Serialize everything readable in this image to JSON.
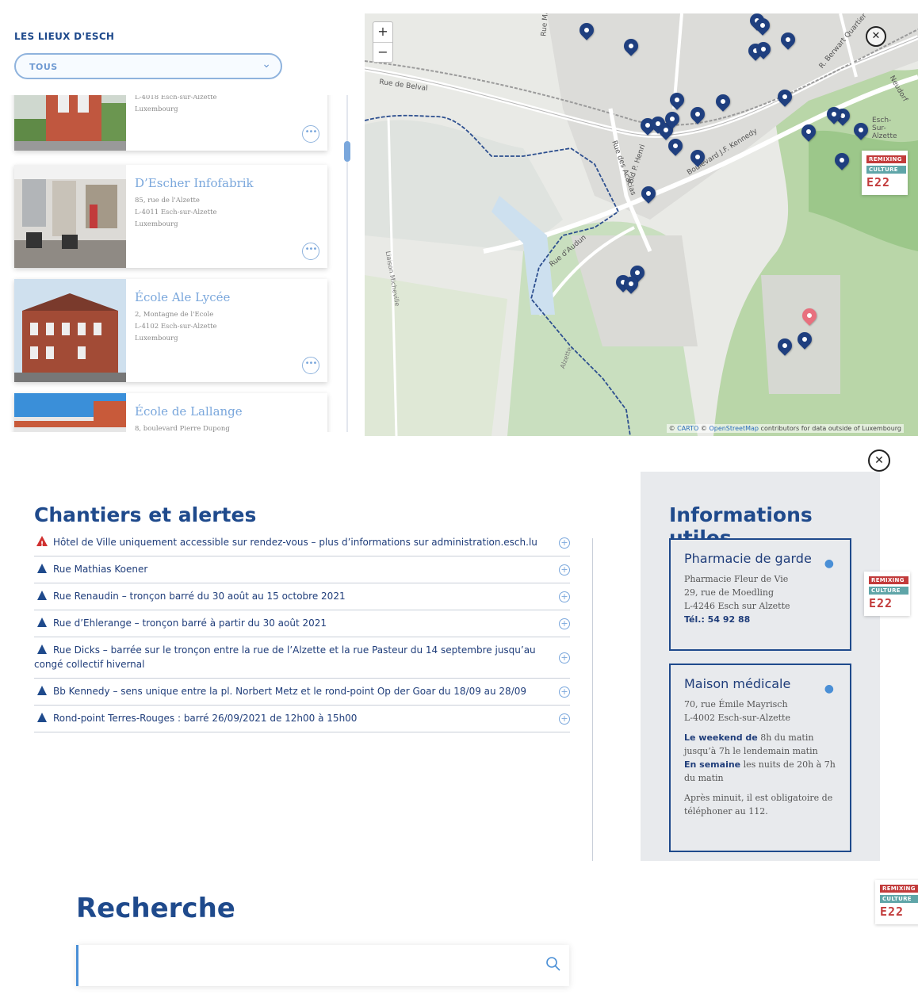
{
  "places": {
    "title": "LES LIEUX D'ESCH",
    "filter_value": "TOUS",
    "cards": [
      {
        "name": "",
        "address": [
          "L-4018 Esch-sur-Alzette",
          "Luxembourg"
        ]
      },
      {
        "name": "D’Escher Infofabrik",
        "address": [
          "85, rue de l'Alzette",
          "L-4011 Esch-sur-Alzette",
          "Luxembourg"
        ]
      },
      {
        "name": "École Ale Lycée",
        "address": [
          "2, Montagne de l'Ecole",
          "L-4102 Esch-sur-Alzette",
          "Luxembourg"
        ]
      },
      {
        "name": "École de Lallange",
        "address": [
          "8, boulevard Pierre Dupong"
        ]
      }
    ]
  },
  "map": {
    "zoom_in": "+",
    "zoom_out": "−",
    "labels": {
      "rue_de_belval": "Rue de Belval",
      "rue_des_acacias": "Rue des Acacias",
      "bld_henri": "Bld P. Henri",
      "bld_kennedy": "Boulevard J.F. Kennedy",
      "rue_audun": "Rue d'Audun",
      "quartier": "R. Berwart Quartier",
      "esch_sur_alzette": "Esch-Sur-Alzette",
      "rue_neudorf": "Neudorf",
      "alzette": "Alzette",
      "liaison": "Liaison Micheville",
      "rue_mai": "Rue Mai"
    },
    "attribution_prefix": "© ",
    "attribution_carto": "CARTO",
    "attribution_osm": "OpenStreetMap",
    "attribution_suffix": " contributors for data outside of Luxembourg"
  },
  "badge": {
    "line1": "REMIXING",
    "line2": "CULTURE",
    "line3": "E22"
  },
  "alerts": {
    "title": "Chantiers et alertes",
    "items": [
      {
        "icon": "warning-icon",
        "text": "Hôtel de Ville uniquement accessible sur rendez-vous – plus d’informations sur administration.esch.lu"
      },
      {
        "icon": "cone-icon",
        "text": "Rue Mathias Koener"
      },
      {
        "icon": "cone-icon",
        "text": "Rue Renaudin – tronçon barré du 30 août au 15 octobre 2021"
      },
      {
        "icon": "cone-icon",
        "text": "Rue d’Ehlerange – tronçon barré à partir du 30 août 2021"
      },
      {
        "icon": "cone-icon",
        "text": "Rue Dicks – barrée sur le tronçon entre la rue de l’Alzette et la rue Pasteur du 14 septembre jusqu’au congé collectif hivernal"
      },
      {
        "icon": "cone-icon",
        "text": "Bb Kennedy – sens unique entre la pl. Norbert Metz et le rond-point Op der Goar du 18/09 au 28/09"
      },
      {
        "icon": "cone-icon",
        "text": "Rond-point Terres-Rouges : barré 26/09/2021 de 12h00 à 15h00"
      }
    ]
  },
  "infos": {
    "title": "Informations utiles",
    "pharmacie": {
      "title": "Pharmacie de garde",
      "lines": [
        "Pharmacie Fleur de Vie",
        "29, rue de Moedling",
        "L-4246 Esch sur Alzette"
      ],
      "tel": "Tél.: 54 92 88"
    },
    "maison": {
      "title": "Maison médicale",
      "lines": [
        "70, rue Émile Mayrisch",
        "L-4002 Esch-sur-Alzette"
      ],
      "weekend_label": "Le weekend de",
      "weekend_text": " 8h du matin jusqu’à 7h le lendemain matin",
      "semaine_label": "En semaine",
      "semaine_text": " les nuits de 20h à 7h du matin",
      "note": "Après minuit, il est obligatoire de téléphoner au 112."
    }
  },
  "search": {
    "title": "Recherche",
    "placeholder": ""
  }
}
